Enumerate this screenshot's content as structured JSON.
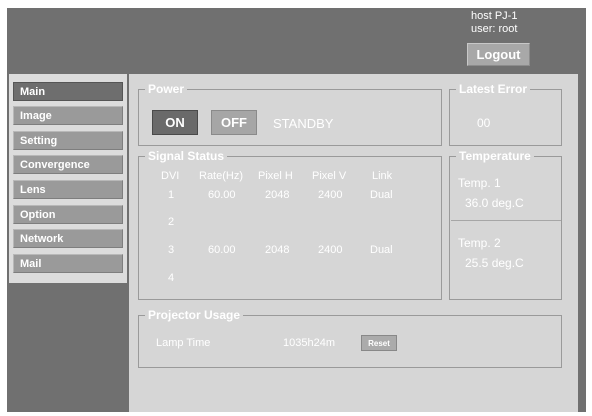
{
  "header": {
    "host": "host PJ-1",
    "user": "user: root",
    "logout_label": "Logout"
  },
  "sidebar": {
    "items": [
      {
        "label": "Main"
      },
      {
        "label": "Image"
      },
      {
        "label": "Setting"
      },
      {
        "label": "Convergence"
      },
      {
        "label": "Lens"
      },
      {
        "label": "Option"
      },
      {
        "label": "Network"
      },
      {
        "label": "Mail"
      }
    ]
  },
  "power": {
    "title": "Power",
    "on_label": "ON",
    "off_label": "OFF",
    "status": "STANDBY"
  },
  "latest_error": {
    "title": "Latest Error",
    "value": "00"
  },
  "signal_status": {
    "title": "Signal Status",
    "headers": [
      "DVI",
      "Rate(Hz)",
      "Pixel H",
      "Pixel V",
      "Link"
    ],
    "rows": [
      [
        "1",
        "60.00",
        "2048",
        "2400",
        "Dual"
      ],
      [
        "2",
        "",
        "",
        "",
        ""
      ],
      [
        "3",
        "60.00",
        "2048",
        "2400",
        "Dual"
      ],
      [
        "4",
        "",
        "",
        "",
        ""
      ]
    ]
  },
  "temperature": {
    "title": "Temperature",
    "sensors": [
      {
        "label": "Temp. 1",
        "value": "36.0 deg.C"
      },
      {
        "label": "Temp. 2",
        "value": "25.5 deg.C"
      }
    ]
  },
  "projector_usage": {
    "title": "Projector Usage",
    "lamp_time_label": "Lamp Time",
    "lamp_time_value": "1035h24m",
    "reset_label": "Reset"
  }
}
